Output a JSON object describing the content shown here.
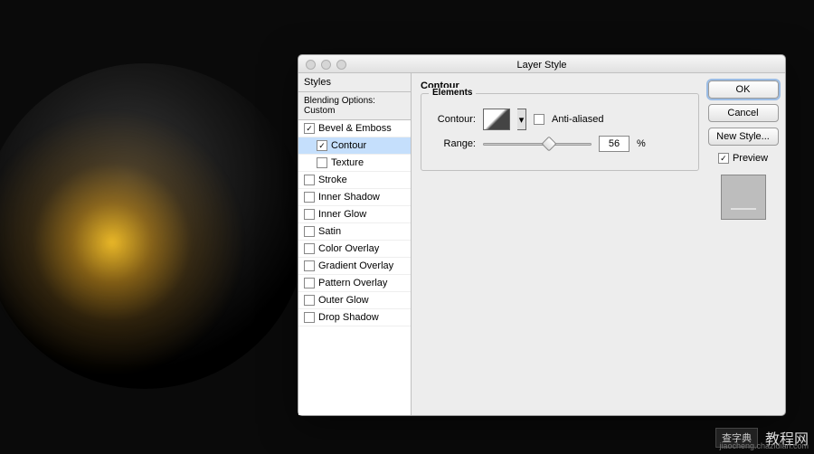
{
  "dialog": {
    "title": "Layer Style"
  },
  "sidebar": {
    "header": "Styles",
    "blending": "Blending Options: Custom",
    "items": [
      {
        "label": "Bevel & Emboss",
        "checked": true,
        "selected": false,
        "indent": false
      },
      {
        "label": "Contour",
        "checked": true,
        "selected": true,
        "indent": true
      },
      {
        "label": "Texture",
        "checked": false,
        "selected": false,
        "indent": true
      },
      {
        "label": "Stroke",
        "checked": false,
        "selected": false,
        "indent": false
      },
      {
        "label": "Inner Shadow",
        "checked": false,
        "selected": false,
        "indent": false
      },
      {
        "label": "Inner Glow",
        "checked": false,
        "selected": false,
        "indent": false
      },
      {
        "label": "Satin",
        "checked": false,
        "selected": false,
        "indent": false
      },
      {
        "label": "Color Overlay",
        "checked": false,
        "selected": false,
        "indent": false
      },
      {
        "label": "Gradient Overlay",
        "checked": false,
        "selected": false,
        "indent": false
      },
      {
        "label": "Pattern Overlay",
        "checked": false,
        "selected": false,
        "indent": false
      },
      {
        "label": "Outer Glow",
        "checked": false,
        "selected": false,
        "indent": false
      },
      {
        "label": "Drop Shadow",
        "checked": false,
        "selected": false,
        "indent": false
      }
    ]
  },
  "panel": {
    "title": "Contour",
    "group": "Elements",
    "contour_label": "Contour:",
    "antialiased": "Anti-aliased",
    "range_label": "Range:",
    "range_value": "56",
    "range_unit": "%"
  },
  "buttons": {
    "ok": "OK",
    "cancel": "Cancel",
    "newstyle": "New Style...",
    "preview": "Preview"
  },
  "watermark": {
    "a": "查字典",
    "b": "教程网",
    "url": "jiaocheng.chazidian.com"
  }
}
